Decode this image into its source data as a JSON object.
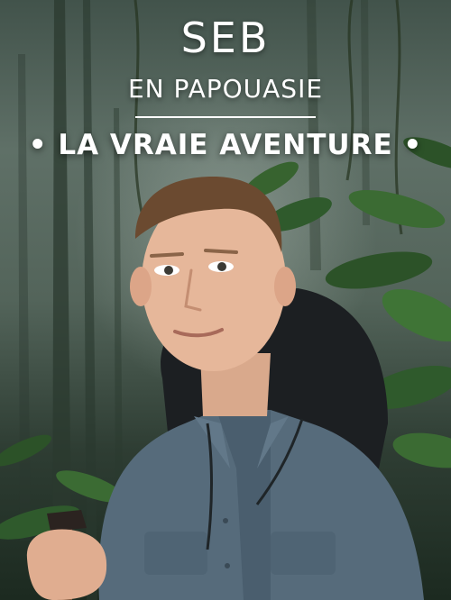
{
  "title": {
    "name": "SEB",
    "subtitle": "EN PAPOUASIE",
    "tagline": "• LA VRAIE AVENTURE •"
  },
  "colors": {
    "text": "#ffffff",
    "shirt": "#566b7b",
    "foliage": "#2f5a2c",
    "mist": "#6b7a70"
  },
  "scene": {
    "subject": "young man in a blue-grey shirt holding a stick",
    "background": "misty rainforest"
  }
}
